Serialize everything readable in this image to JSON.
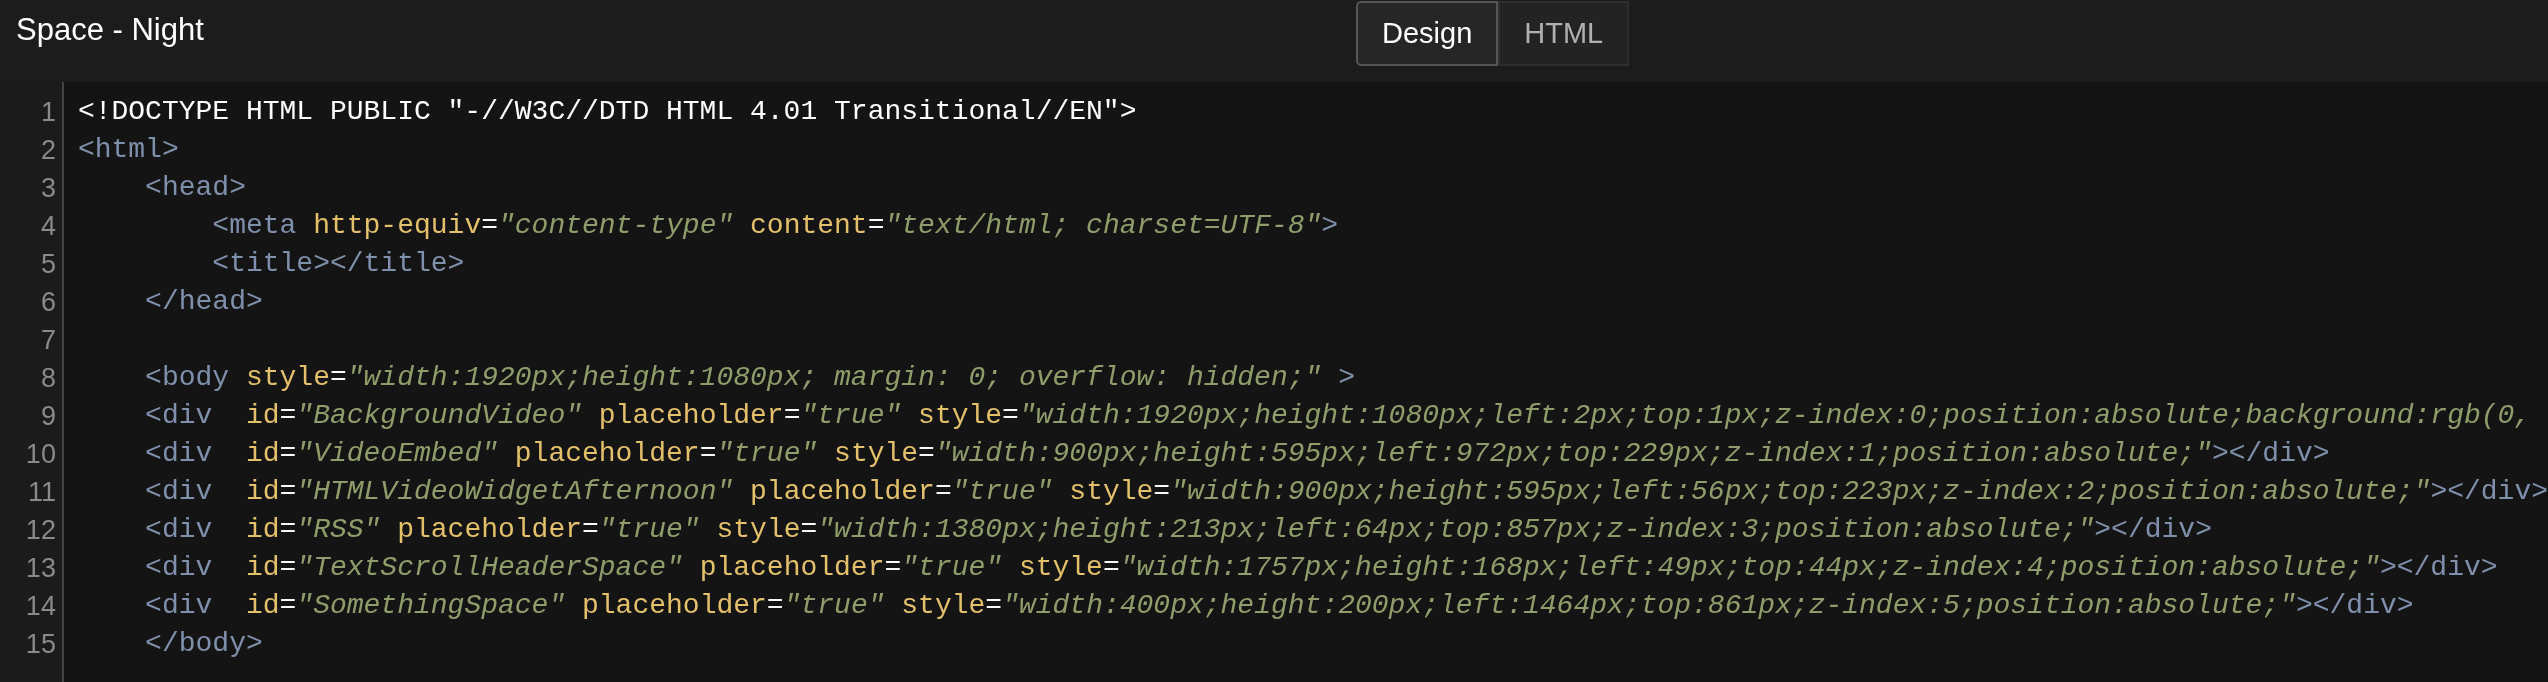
{
  "window": {
    "title": "Space - Night"
  },
  "tabs": [
    {
      "label": "Design",
      "selected": true
    },
    {
      "label": "HTML",
      "selected": false
    }
  ],
  "editor": {
    "lines": [
      {
        "number": "1",
        "tokens": [
          {
            "kind": "doctype",
            "text": "<!DOCTYPE HTML PUBLIC \"-//W3C//DTD HTML 4.01 Transitional//EN\">"
          }
        ]
      },
      {
        "number": "2",
        "tokens": [
          {
            "kind": "tag",
            "text": "<html>"
          }
        ]
      },
      {
        "number": "3",
        "tokens": [
          {
            "kind": "tag",
            "text": "    <head>"
          }
        ]
      },
      {
        "number": "4",
        "tokens": [
          {
            "kind": "tag",
            "text": "        <meta "
          },
          {
            "kind": "attr",
            "text": "http-equiv"
          },
          {
            "kind": "plain",
            "text": "="
          },
          {
            "kind": "value",
            "text": "\"content-type\" "
          },
          {
            "kind": "attr",
            "text": "content"
          },
          {
            "kind": "plain",
            "text": "="
          },
          {
            "kind": "value",
            "text": "\"text/html; charset=UTF-8\""
          },
          {
            "kind": "tag",
            "text": ">"
          }
        ]
      },
      {
        "number": "5",
        "tokens": [
          {
            "kind": "tag",
            "text": "        <title></title>"
          }
        ]
      },
      {
        "number": "6",
        "tokens": [
          {
            "kind": "tag",
            "text": "    </head>"
          }
        ]
      },
      {
        "number": "7"
      },
      {
        "number": "8",
        "tokens": [
          {
            "kind": "tag",
            "text": "    <body "
          },
          {
            "kind": "attr",
            "text": "style"
          },
          {
            "kind": "plain",
            "text": "="
          },
          {
            "kind": "value",
            "text": "\"width:1920px;height:1080px; margin: 0; overflow: hidden;\" "
          },
          {
            "kind": "tag",
            "text": ">"
          }
        ]
      },
      {
        "number": "9",
        "tokens": [
          {
            "kind": "tag",
            "text": "    <div  "
          },
          {
            "kind": "attr",
            "text": "id"
          },
          {
            "kind": "plain",
            "text": "="
          },
          {
            "kind": "value",
            "text": "\"BackgroundVideo\" "
          },
          {
            "kind": "attr",
            "text": "placeholder"
          },
          {
            "kind": "plain",
            "text": "="
          },
          {
            "kind": "value",
            "text": "\"true\" "
          },
          {
            "kind": "attr",
            "text": "style"
          },
          {
            "kind": "plain",
            "text": "="
          },
          {
            "kind": "value",
            "text": "\"width:1920px;height:1080px;left:2px;top:1px;z-index:0;position:absolute;background:rgb(0,"
          }
        ]
      },
      {
        "number": "10",
        "tokens": [
          {
            "kind": "tag",
            "text": "    <div  "
          },
          {
            "kind": "attr",
            "text": "id"
          },
          {
            "kind": "plain",
            "text": "="
          },
          {
            "kind": "value",
            "text": "\"VideoEmbed\" "
          },
          {
            "kind": "attr",
            "text": "placeholder"
          },
          {
            "kind": "plain",
            "text": "="
          },
          {
            "kind": "value",
            "text": "\"true\" "
          },
          {
            "kind": "attr",
            "text": "style"
          },
          {
            "kind": "plain",
            "text": "="
          },
          {
            "kind": "value",
            "text": "\"width:900px;height:595px;left:972px;top:229px;z-index:1;position:absolute;\""
          },
          {
            "kind": "tag",
            "text": "></div>"
          }
        ]
      },
      {
        "number": "11",
        "tokens": [
          {
            "kind": "tag",
            "text": "    <div  "
          },
          {
            "kind": "attr",
            "text": "id"
          },
          {
            "kind": "plain",
            "text": "="
          },
          {
            "kind": "value",
            "text": "\"HTMLVideoWidgetAfternoon\" "
          },
          {
            "kind": "attr",
            "text": "placeholder"
          },
          {
            "kind": "plain",
            "text": "="
          },
          {
            "kind": "value",
            "text": "\"true\" "
          },
          {
            "kind": "attr",
            "text": "style"
          },
          {
            "kind": "plain",
            "text": "="
          },
          {
            "kind": "value",
            "text": "\"width:900px;height:595px;left:56px;top:223px;z-index:2;position:absolute;\""
          },
          {
            "kind": "tag",
            "text": "></div>"
          }
        ]
      },
      {
        "number": "12",
        "tokens": [
          {
            "kind": "tag",
            "text": "    <div  "
          },
          {
            "kind": "attr",
            "text": "id"
          },
          {
            "kind": "plain",
            "text": "="
          },
          {
            "kind": "value",
            "text": "\"RSS\" "
          },
          {
            "kind": "attr",
            "text": "placeholder"
          },
          {
            "kind": "plain",
            "text": "="
          },
          {
            "kind": "value",
            "text": "\"true\" "
          },
          {
            "kind": "attr",
            "text": "style"
          },
          {
            "kind": "plain",
            "text": "="
          },
          {
            "kind": "value",
            "text": "\"width:1380px;height:213px;left:64px;top:857px;z-index:3;position:absolute;\""
          },
          {
            "kind": "tag",
            "text": "></div>"
          }
        ]
      },
      {
        "number": "13",
        "tokens": [
          {
            "kind": "tag",
            "text": "    <div  "
          },
          {
            "kind": "attr",
            "text": "id"
          },
          {
            "kind": "plain",
            "text": "="
          },
          {
            "kind": "value",
            "text": "\"TextScrollHeaderSpace\" "
          },
          {
            "kind": "attr",
            "text": "placeholder"
          },
          {
            "kind": "plain",
            "text": "="
          },
          {
            "kind": "value",
            "text": "\"true\" "
          },
          {
            "kind": "attr",
            "text": "style"
          },
          {
            "kind": "plain",
            "text": "="
          },
          {
            "kind": "value",
            "text": "\"width:1757px;height:168px;left:49px;top:44px;z-index:4;position:absolute;\""
          },
          {
            "kind": "tag",
            "text": "></div>"
          }
        ]
      },
      {
        "number": "14",
        "tokens": [
          {
            "kind": "tag",
            "text": "    <div  "
          },
          {
            "kind": "attr",
            "text": "id"
          },
          {
            "kind": "plain",
            "text": "="
          },
          {
            "kind": "value",
            "text": "\"SomethingSpace\" "
          },
          {
            "kind": "attr",
            "text": "placeholder"
          },
          {
            "kind": "plain",
            "text": "="
          },
          {
            "kind": "value",
            "text": "\"true\" "
          },
          {
            "kind": "attr",
            "text": "style"
          },
          {
            "kind": "plain",
            "text": "="
          },
          {
            "kind": "value",
            "text": "\"width:400px;height:200px;left:1464px;top:861px;z-index:5;position:absolute;\""
          },
          {
            "kind": "tag",
            "text": "></div>"
          }
        ]
      },
      {
        "number": "15",
        "tokens": [
          {
            "kind": "tag",
            "text": "    </body>"
          }
        ]
      }
    ]
  }
}
